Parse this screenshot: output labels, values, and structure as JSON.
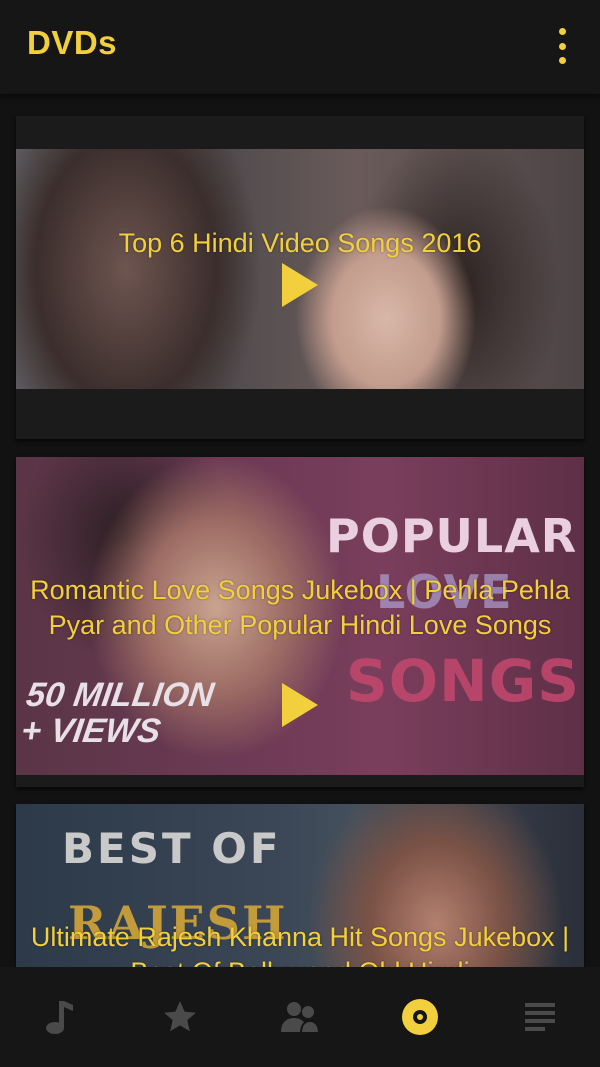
{
  "app_bar": {
    "title": "DVDs",
    "menu_icon": "more-vert-icon"
  },
  "videos": [
    {
      "title": "Top 6 Hindi Video Songs 2016"
    },
    {
      "title": "Romantic Love Songs Jukebox | Pehla Pehla Pyar and Other Popular Hindi Love Songs",
      "thumb_text": {
        "popular": "POPULAR",
        "love": "LOVE",
        "songs": "SONGS",
        "views_line1": "50 MILLION",
        "views_line2": "+ VIEWS"
      }
    },
    {
      "title": "Ultimate Rajesh Khanna Hit Songs Jukebox | Best Of Bollywood Old Hindi",
      "thumb_text": {
        "best_of": "BEST OF",
        "name": "RAJESH"
      }
    }
  ],
  "bottom_nav": [
    {
      "icon": "music-note-icon",
      "active": false
    },
    {
      "icon": "star-icon",
      "active": false
    },
    {
      "icon": "people-icon",
      "active": false
    },
    {
      "icon": "disc-icon",
      "active": true
    },
    {
      "icon": "list-icon",
      "active": false
    }
  ],
  "colors": {
    "accent": "#f2cf3c",
    "background": "#121212",
    "inactive_icon": "#4a4a4a"
  }
}
